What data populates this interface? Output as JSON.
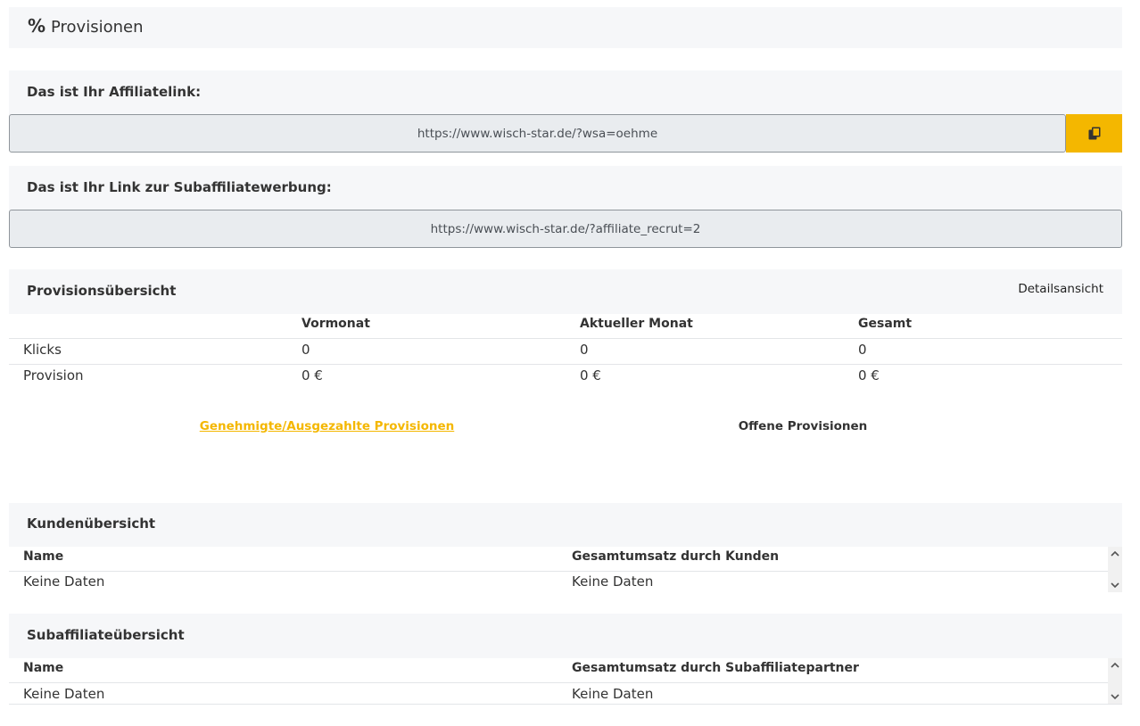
{
  "header": {
    "icon": "percent-icon",
    "icon_glyph": "%",
    "title": "Provisionen"
  },
  "affiliate": {
    "label": "Das ist Ihr Affiliatelink:",
    "value": "https://www.wisch-star.de/?wsa=oehme",
    "copy_icon": "copy-icon"
  },
  "subaffiliate": {
    "label": "Das ist Ihr Link zur Subaffiliatewerbung:",
    "value": "https://www.wisch-star.de/?affiliate_recrut=2"
  },
  "overview": {
    "title": "Provisionsübersicht",
    "detail_link": "Detailsansicht",
    "columns": [
      "",
      "Vormonat",
      "Aktueller Monat",
      "Gesamt"
    ],
    "rows": [
      {
        "label": "Klicks",
        "cells": [
          "0",
          "0",
          "0"
        ]
      },
      {
        "label": "Provision",
        "cells": [
          "0 €",
          "0 €",
          "0 €"
        ]
      }
    ],
    "tabs": [
      "Genehmigte/Ausgezahlte Provisionen",
      "Offene Provisionen"
    ]
  },
  "customers": {
    "title": "Kundenübersicht",
    "columns": [
      "Name",
      "Gesamtumsatz durch Kunden"
    ],
    "row": [
      "Keine Daten",
      "Keine Daten"
    ]
  },
  "subaffiliates": {
    "title": "Subaffiliateübersicht",
    "columns": [
      "Name",
      "Gesamtumsatz durch Subaffiliatepartner"
    ],
    "row": [
      "Keine Daten",
      "Keine Daten"
    ]
  },
  "colors": {
    "accent": "#f4b700",
    "panel": "#f6f7f9",
    "field": "#e9ecef"
  }
}
